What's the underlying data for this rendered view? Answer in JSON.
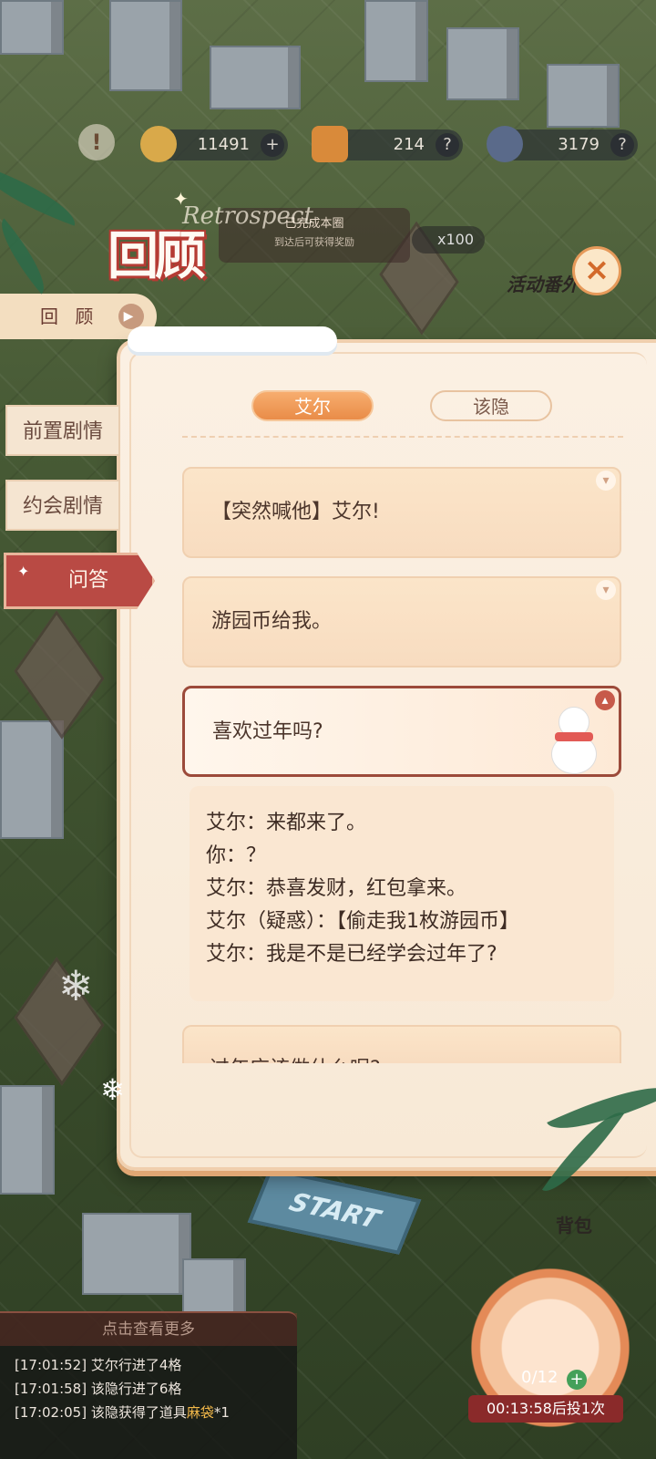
{
  "currency": [
    {
      "name": "coins",
      "value": "11491",
      "icon": "coin-icon",
      "button": "+"
    },
    {
      "name": "lantern",
      "value": "214",
      "icon": "lantern-icon",
      "button": "?"
    },
    {
      "name": "time",
      "value": "3179",
      "icon": "clock-icon",
      "button": "?"
    }
  ],
  "header": {
    "title": "回顾",
    "subtitle": "Retrospect",
    "close_symbol": "×",
    "side_review_label": "回 顾",
    "event_text": "已完成本圈",
    "event_sub": "到达后可获得奖励",
    "reward_badge": "x100",
    "activity_label": "活动番外"
  },
  "tabs": [
    {
      "label": "艾尔",
      "active": true
    },
    {
      "label": "该隐",
      "active": false
    }
  ],
  "side_menu": [
    {
      "label": "前置剧情",
      "active": false
    },
    {
      "label": "约会剧情",
      "active": false
    },
    {
      "label": "问答",
      "active": true
    }
  ],
  "questions": [
    {
      "text": "【突然喊他】艾尔!",
      "open": false
    },
    {
      "text": "游园币给我。",
      "open": false
    },
    {
      "text": "喜欢过年吗?",
      "open": true
    },
    {
      "text": "过年应该做什么呢?",
      "open": false
    }
  ],
  "answer_lines": [
    "艾尔：来都来了。",
    "你：？",
    "艾尔：恭喜发财，红包拿来。",
    "艾尔（疑惑）：【偷走我1枚游园币】",
    "艾尔：我是不是已经学会过年了?"
  ],
  "log": {
    "header": "点击查看更多",
    "entries": [
      {
        "time": "[17:01:52]",
        "text": "艾尔行进了4格",
        "item": "",
        "suffix": ""
      },
      {
        "time": "[17:01:58]",
        "text": "该隐行进了6格",
        "item": "",
        "suffix": ""
      },
      {
        "time": "[17:02:05]",
        "text": "该隐获得了道具",
        "item": "麻袋",
        "suffix": "*1"
      }
    ]
  },
  "board": {
    "start_label": "START",
    "bag_label": "背包",
    "dice_count": "0/12",
    "timer": "00:13:58后投1次"
  },
  "colors": {
    "accent": "#e98c48",
    "active_menu": "#b94a44",
    "panel_bg": "#fbf0e3"
  }
}
